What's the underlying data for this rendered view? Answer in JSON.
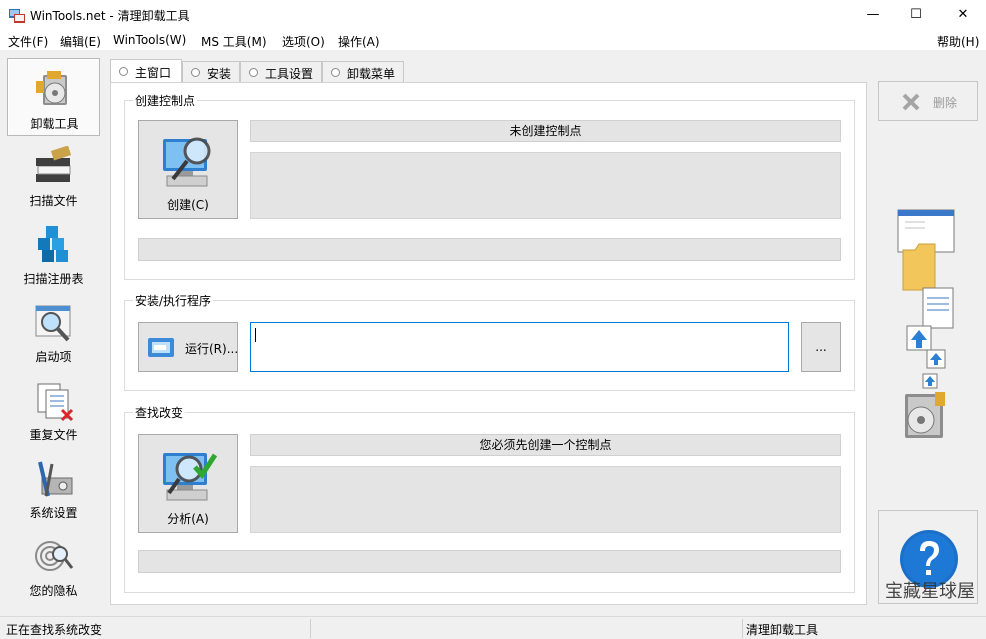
{
  "window": {
    "title": "WinTools.net - 清理卸载工具",
    "minimize": "—",
    "maximize": "☐",
    "close": "✕"
  },
  "menu": {
    "file": "文件(F)",
    "edit": "编辑(E)",
    "wintools": "WinTools(W)",
    "ms_tools": "MS 工具(M)",
    "options": "选项(O)",
    "actions": "操作(A)",
    "help": "帮助(H)"
  },
  "sidebar": {
    "items": [
      {
        "label": "卸载工具",
        "icon": "uninstall-icon",
        "active": true
      },
      {
        "label": "扫描文件",
        "icon": "scan-files-icon"
      },
      {
        "label": "扫描注册表",
        "icon": "scan-registry-icon"
      },
      {
        "label": "启动项",
        "icon": "startup-icon"
      },
      {
        "label": "重复文件",
        "icon": "duplicate-files-icon"
      },
      {
        "label": "系统设置",
        "icon": "system-settings-icon"
      },
      {
        "label": "您的隐私",
        "icon": "privacy-icon"
      }
    ]
  },
  "tabs": [
    {
      "label": "主窗口",
      "active": true
    },
    {
      "label": "安装"
    },
    {
      "label": "工具设置"
    },
    {
      "label": "卸载菜单"
    }
  ],
  "create_group": {
    "title": "创建控制点",
    "button_label": "创建(C)",
    "status": "未创建控制点"
  },
  "install_group": {
    "title": "安装/执行程序",
    "run_label": "运行(R)...",
    "input_value": "",
    "browse_label": "..."
  },
  "find_group": {
    "title": "查找改变",
    "button_label": "分析(A)",
    "status": "您必须先创建一个控制点"
  },
  "right_panel": {
    "delete_label": "删除",
    "help_icon": "help-icon"
  },
  "watermark": "宝藏星球屋",
  "statusbar": {
    "left": "正在查找系统改变",
    "right": "清理卸载工具"
  },
  "colors": {
    "accent": "#0078d7",
    "help_blue": "#1b6fc6",
    "check_green": "#2fa82f",
    "delete_red": "#d9262b"
  }
}
